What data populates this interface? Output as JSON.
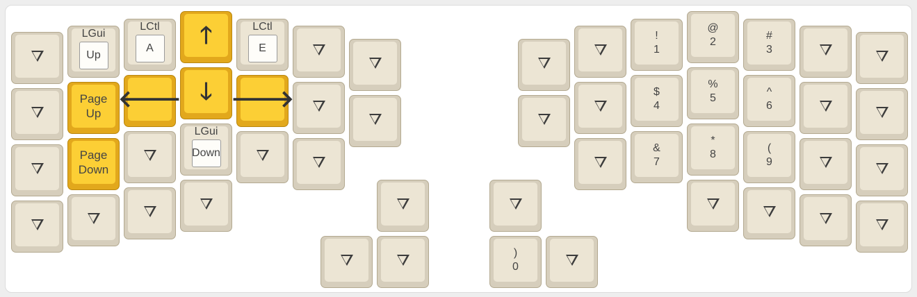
{
  "colors": {
    "key_base": "#d6cebc",
    "key_top": "#ece5d4",
    "highlight_base": "#e2a81c",
    "highlight_top": "#fccf35",
    "text": "#444444"
  },
  "trans_glyph": "▽",
  "keys": [
    {
      "id": "l0-0",
      "type": "trans"
    },
    {
      "id": "l0-1",
      "type": "trans"
    },
    {
      "id": "l0-2",
      "type": "trans"
    },
    {
      "id": "l0-3",
      "type": "trans"
    },
    {
      "id": "l1-0",
      "type": "hold",
      "hold": "LGui",
      "tap": "Up"
    },
    {
      "id": "l1-1",
      "type": "text",
      "hl": true,
      "lines": [
        "Page",
        "Up"
      ]
    },
    {
      "id": "l1-2",
      "type": "text",
      "hl": true,
      "lines": [
        "Page",
        "Down"
      ]
    },
    {
      "id": "l1-3",
      "type": "trans"
    },
    {
      "id": "l2-0",
      "type": "hold",
      "hold": "LCtl",
      "tap": "A"
    },
    {
      "id": "l2-1",
      "type": "glyph",
      "hl": true,
      "glyph": "🡐",
      "icon": "arrow-left-icon"
    },
    {
      "id": "l2-2",
      "type": "trans"
    },
    {
      "id": "l2-3",
      "type": "trans"
    },
    {
      "id": "l3-0",
      "type": "glyph",
      "hl": true,
      "glyph": "🡑",
      "icon": "arrow-up-icon"
    },
    {
      "id": "l3-1",
      "type": "glyph",
      "hl": true,
      "glyph": "🡓",
      "icon": "arrow-down-icon"
    },
    {
      "id": "l3-2",
      "type": "hold",
      "hold": "LGui",
      "tap": "Down"
    },
    {
      "id": "l3-3",
      "type": "trans"
    },
    {
      "id": "l4-0",
      "type": "hold",
      "hold": "LCtl",
      "tap": "E"
    },
    {
      "id": "l4-1",
      "type": "glyph",
      "hl": true,
      "glyph": "🡒",
      "icon": "arrow-right-icon"
    },
    {
      "id": "l4-2",
      "type": "trans"
    },
    {
      "id": "l5-0",
      "type": "trans"
    },
    {
      "id": "l5-1",
      "type": "trans"
    },
    {
      "id": "l5-2",
      "type": "trans"
    },
    {
      "id": "l6-0",
      "type": "trans"
    },
    {
      "id": "l6-1",
      "type": "trans"
    },
    {
      "id": "lt-0",
      "type": "trans"
    },
    {
      "id": "lt-1",
      "type": "trans"
    },
    {
      "id": "lt-2",
      "type": "trans"
    },
    {
      "id": "rt-0",
      "type": "trans"
    },
    {
      "id": "rt-1",
      "type": "sym",
      "lines": [
        ")",
        "0"
      ]
    },
    {
      "id": "rt-2",
      "type": "trans"
    },
    {
      "id": "r0-0",
      "type": "trans"
    },
    {
      "id": "r0-1",
      "type": "trans"
    },
    {
      "id": "r1-0",
      "type": "trans"
    },
    {
      "id": "r1-1",
      "type": "trans"
    },
    {
      "id": "r1-2",
      "type": "trans"
    },
    {
      "id": "r2-0",
      "type": "sym",
      "lines": [
        "!",
        "1"
      ]
    },
    {
      "id": "r2-1",
      "type": "sym",
      "lines": [
        "$",
        "4"
      ]
    },
    {
      "id": "r2-2",
      "type": "sym",
      "lines": [
        "&",
        "7"
      ]
    },
    {
      "id": "r3-0",
      "type": "sym",
      "lines": [
        "@",
        "2"
      ]
    },
    {
      "id": "r3-1",
      "type": "sym",
      "lines": [
        "%",
        "5"
      ]
    },
    {
      "id": "r3-2",
      "type": "sym",
      "lines": [
        "*",
        "8"
      ]
    },
    {
      "id": "r3-3",
      "type": "trans"
    },
    {
      "id": "r4-0",
      "type": "sym",
      "lines": [
        "#",
        "3"
      ]
    },
    {
      "id": "r4-1",
      "type": "sym",
      "lines": [
        "^",
        "6"
      ]
    },
    {
      "id": "r4-2",
      "type": "sym",
      "lines": [
        "(",
        "9"
      ]
    },
    {
      "id": "r4-3",
      "type": "trans"
    },
    {
      "id": "r5-0",
      "type": "trans"
    },
    {
      "id": "r5-1",
      "type": "trans"
    },
    {
      "id": "r5-2",
      "type": "trans"
    },
    {
      "id": "r5-3",
      "type": "trans"
    },
    {
      "id": "r6-0",
      "type": "trans"
    },
    {
      "id": "r6-1",
      "type": "trans"
    },
    {
      "id": "r6-2",
      "type": "trans"
    },
    {
      "id": "r6-3",
      "type": "trans"
    }
  ]
}
